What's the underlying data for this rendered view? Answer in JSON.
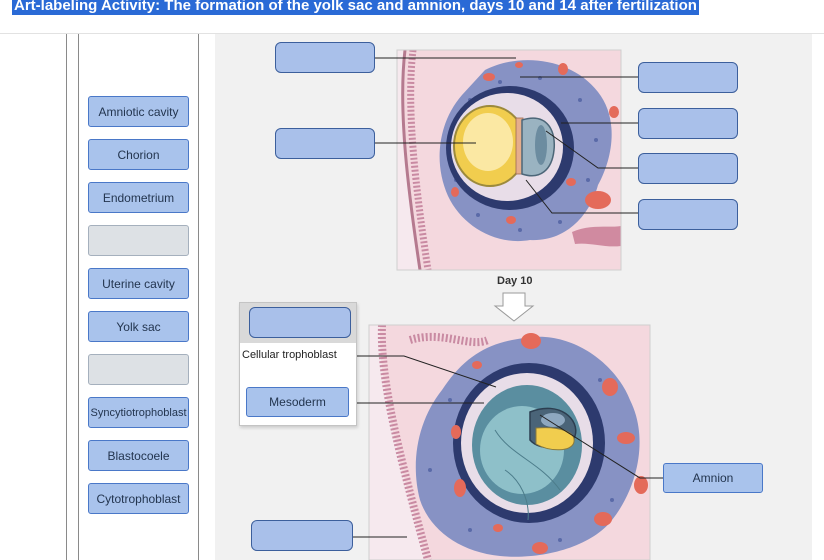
{
  "title": "Art-labeling Activity: The formation of the yolk sac and amnion, days 10 and 14 after fertilization",
  "label_bank": [
    "Amniotic cavity",
    "Chorion",
    "Endometrium",
    "",
    "Uterine cavity",
    "Yolk sac",
    "",
    "Syncytiotrophoblast",
    "Blastocoele",
    "Cytotrophoblast"
  ],
  "day10": {
    "caption": "Day 10"
  },
  "day14": {
    "placed": {
      "cellular_trophoblast": "Cellular trophoblast",
      "mesoderm": "Mesoderm",
      "amnion": "Amnion"
    }
  }
}
